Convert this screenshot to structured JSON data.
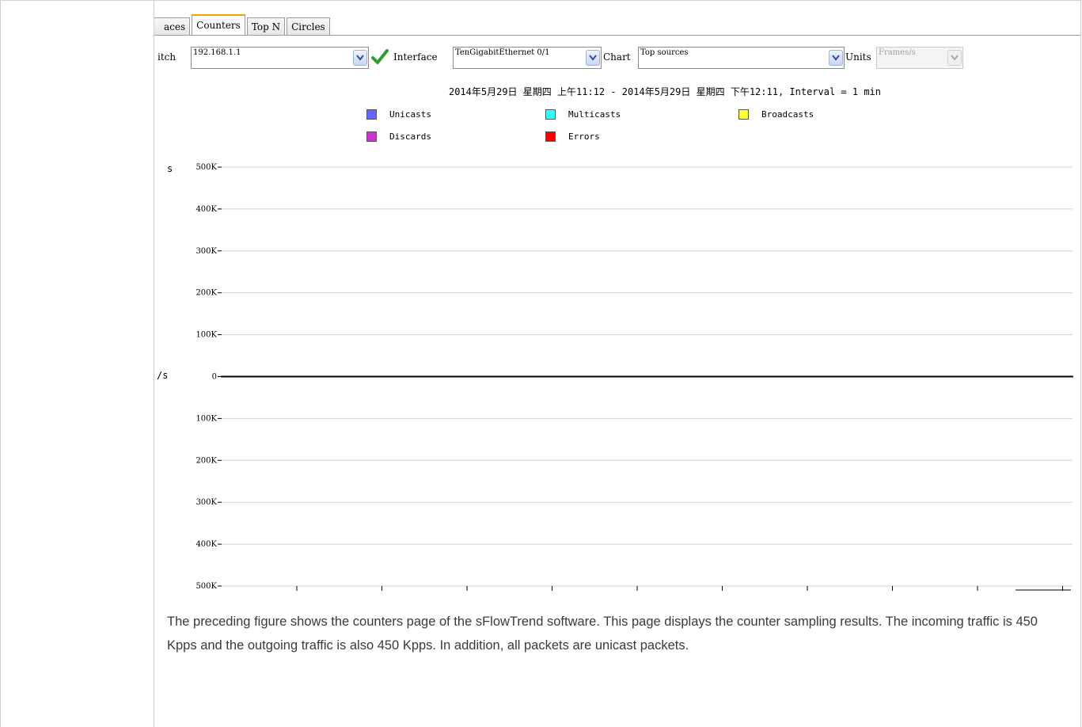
{
  "tabs": [
    {
      "label": "aces",
      "active": false
    },
    {
      "label": "Counters",
      "active": true
    },
    {
      "label": "Top N",
      "active": false
    },
    {
      "label": "Circles",
      "active": false
    }
  ],
  "toolbar": {
    "switch_label": "itch",
    "switch_value": "192.168.1.1",
    "interface_label": "Interface",
    "interface_value": "TenGigabitEthernet 0/1",
    "chart_label": "Chart",
    "chart_value": "Top sources",
    "units_label": "Units",
    "units_value": "Frames/s"
  },
  "chart": {
    "title": "2014年5月29日 星期四 上午11:12 - 2014年5月29日 星期四 下午12:11, Interval = 1 min",
    "legend": [
      {
        "name": "Unicasts",
        "color": "#6666ff"
      },
      {
        "name": "Multicasts",
        "color": "#33ffff"
      },
      {
        "name": "Broadcasts",
        "color": "#ffff33"
      },
      {
        "name": "Discards",
        "color": "#cc33cc"
      },
      {
        "name": "Errors",
        "color": "#ff0000"
      }
    ],
    "side_label_top": "s",
    "side_label_mid": "/s",
    "colors": {
      "in": "#6666ff",
      "out": "#4444aa"
    }
  },
  "chart_data": {
    "type": "area",
    "title": "2014年5月29日 星期四 上午11:12 - 2014年5月29日 星期四 下午12:11, Interval = 1 min",
    "ylabel": "",
    "ylim": [
      -500000,
      500000
    ],
    "yticks": [
      {
        "label": "500K",
        "value": 500000
      },
      {
        "label": "400K",
        "value": 400000
      },
      {
        "label": "300K",
        "value": 300000
      },
      {
        "label": "200K",
        "value": 200000
      },
      {
        "label": "100K",
        "value": 100000
      },
      {
        "label": "0",
        "value": 0
      },
      {
        "label": "100K",
        "value": -100000
      },
      {
        "label": "200K",
        "value": -200000
      },
      {
        "label": "300K",
        "value": -300000
      },
      {
        "label": "400K",
        "value": -400000
      },
      {
        "label": "500K",
        "value": -500000
      }
    ],
    "x": [
      0,
      1,
      2,
      3,
      4,
      5,
      6,
      7,
      8,
      9,
      10,
      11,
      12,
      13,
      14,
      15,
      16,
      17,
      18,
      19,
      20,
      21,
      22,
      23,
      24,
      25,
      26,
      27,
      28,
      29,
      30,
      31,
      32,
      33,
      34,
      35,
      36,
      37,
      38,
      39,
      40,
      41,
      42,
      43,
      44,
      45,
      46,
      47,
      48,
      49,
      50,
      51,
      52,
      53,
      54,
      55,
      56,
      57,
      58,
      59
    ],
    "series": [
      {
        "name": "Unicasts",
        "values": [
          0,
          0,
          0,
          0,
          0,
          0,
          0,
          0,
          0,
          0,
          0,
          0,
          0,
          0,
          0,
          0,
          0,
          0,
          0,
          0,
          0,
          0,
          0,
          0,
          0,
          0,
          0,
          0,
          0,
          0,
          0,
          0,
          0,
          0,
          0,
          0,
          0,
          0,
          0,
          0,
          0,
          0,
          0,
          0,
          0,
          0,
          0,
          0,
          0,
          0,
          0,
          0,
          0,
          0,
          0,
          0,
          0,
          0,
          0,
          0
        ],
        "in": [
          0,
          0,
          0,
          0,
          0,
          0,
          0,
          0,
          0,
          0,
          0,
          0,
          0,
          0,
          0,
          0,
          0,
          0,
          0,
          0,
          0,
          0,
          0,
          0,
          0,
          0,
          0,
          0,
          0,
          0,
          0,
          0,
          0,
          0,
          0,
          0,
          0,
          0,
          0,
          0,
          0,
          0,
          0,
          0,
          0,
          0,
          0,
          0,
          0,
          0,
          0,
          0,
          0,
          0,
          0,
          0,
          0,
          0,
          0,
          0
        ],
        "out": [
          0,
          0,
          0,
          0,
          0,
          0,
          0,
          0,
          0,
          0,
          0,
          0,
          0,
          0,
          0,
          0,
          0,
          0,
          0,
          0,
          0,
          0,
          0,
          0,
          0,
          0,
          0,
          0,
          0,
          0,
          0,
          0,
          0,
          0,
          0,
          0,
          0,
          0,
          0,
          0,
          0,
          0,
          0,
          0,
          0,
          0,
          0,
          0,
          0,
          0,
          0,
          0,
          0,
          0,
          0,
          0,
          0,
          0,
          0,
          0
        ]
      }
    ],
    "grid": true,
    "legend_position": "top"
  },
  "caption": "The preceding figure shows the counters page of the sFlowTrend software. This page displays the counter sampling results. The incoming traffic is 450 Kpps and the outgoing traffic is also 450 Kpps. In addition, all packets are unicast packets."
}
